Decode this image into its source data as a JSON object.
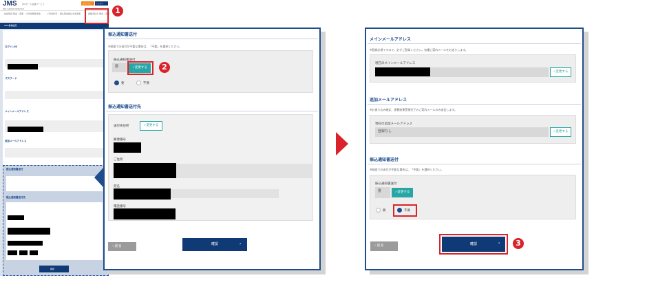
{
  "overview": {
    "logo": "JMS",
    "logo_sub": "JMS GROUP SERVICE",
    "header_tagline": "JMSカード会員サービス",
    "header_btn_1": "ログアウト",
    "header_btn_2": "トップへ",
    "nav": [
      "会員情報\n照会・変更",
      "ご利用明細\n照会",
      "ご利用状況・\n振込照会",
      "振込方法変更",
      "各種手続き\n照会・変更"
    ],
    "page_heading": "Web各種設定",
    "lines": [
      "ログインID",
      "パスワード",
      "メインメールアドレス",
      "追加メールアドレス",
      "振込通知書送付",
      "振込通知書送付先"
    ],
    "confirm": "確認"
  },
  "panel1": {
    "section_title": "振込通知書送付",
    "note": "※紙面での送付が不要な場合は、「不要」を選択ください。",
    "field_label": "振込通知書送付",
    "field_value": "要",
    "change_label": "変更する",
    "radio_yes": "要",
    "radio_no": "不要",
    "addr_title": "振込通知書送付先",
    "dest_label": "送付先住所",
    "dest_change": "変更する",
    "postal_label": "郵便番号",
    "address_label": "ご住所",
    "name_label": "宛名",
    "phone_label": "電話番号",
    "back": "戻る",
    "confirm": "確認"
  },
  "panel2": {
    "main_title": "メインメールアドレス",
    "main_note": "※登録必須ですので、必ずご登録ください。各種ご案内メールをお送りします。",
    "main_label": "現在のメインメールアドレス",
    "main_change": "変更する",
    "add_title": "追加メールアドレス",
    "add_note": "※お振り込み確定、振替結果受領完了のご案内メールのみ送信します。",
    "add_label": "現在の追加メールアドレス",
    "add_value": "登録なし",
    "add_change": "変更する",
    "notice_title": "振込通知書送付",
    "notice_note": "※紙面での送付が不要な場合は、「不要」を選択ください。",
    "field_label": "振込通知書送付",
    "field_value": "要",
    "change_label": "変更する",
    "radio_yes": "要",
    "radio_no": "不要",
    "back": "戻る",
    "confirm": "確認"
  },
  "steps": [
    "1",
    "2",
    "3"
  ],
  "colors": {
    "brand": "#1e4c8c",
    "accent_red": "#d9232a",
    "teal": "#27a6a6"
  }
}
